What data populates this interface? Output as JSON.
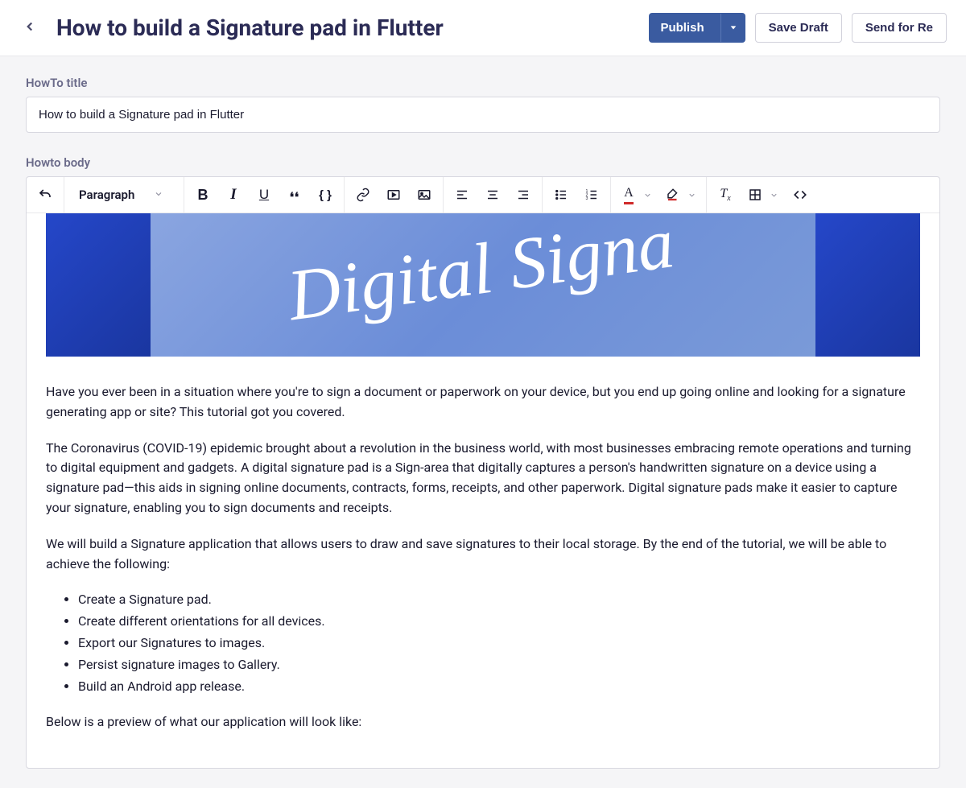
{
  "header": {
    "title": "How to build a Signature pad in Flutter",
    "publish": "Publish",
    "save_draft": "Save Draft",
    "send_for_review": "Send for Re"
  },
  "form": {
    "title_label": "HowTo title",
    "title_value": "How to build a Signature pad in Flutter",
    "body_label": "Howto body"
  },
  "toolbar": {
    "block_format": "Paragraph"
  },
  "hero": {
    "text": "Digital Signa"
  },
  "body": {
    "p1": "Have you ever been in a situation where you're to sign a document or paperwork on your device, but you end up going online and looking for a signature generating app or site? This tutorial got you covered.",
    "p2": "The Coronavirus (COVID-19) epidemic brought about a revolution in the business world, with most businesses embracing remote operations and turning to digital equipment and gadgets. A digital signature pad is a Sign-area that digitally captures a person's handwritten signature on a device using a signature pad—this aids in signing online documents, contracts, forms, receipts, and other paperwork. Digital signature pads make it easier to capture your signature, enabling you to sign documents and receipts.",
    "p3": "We will build a Signature application that allows users to draw and save signatures to their local storage. By the end of the tutorial, we will be able to achieve the following:",
    "bullets": [
      "Create a Signature pad.",
      "Create different orientations for all devices.",
      "Export our Signatures to images.",
      "Persist signature images to Gallery.",
      "Build an Android app release."
    ],
    "p4": "Below is a preview of what our application will look like:"
  }
}
